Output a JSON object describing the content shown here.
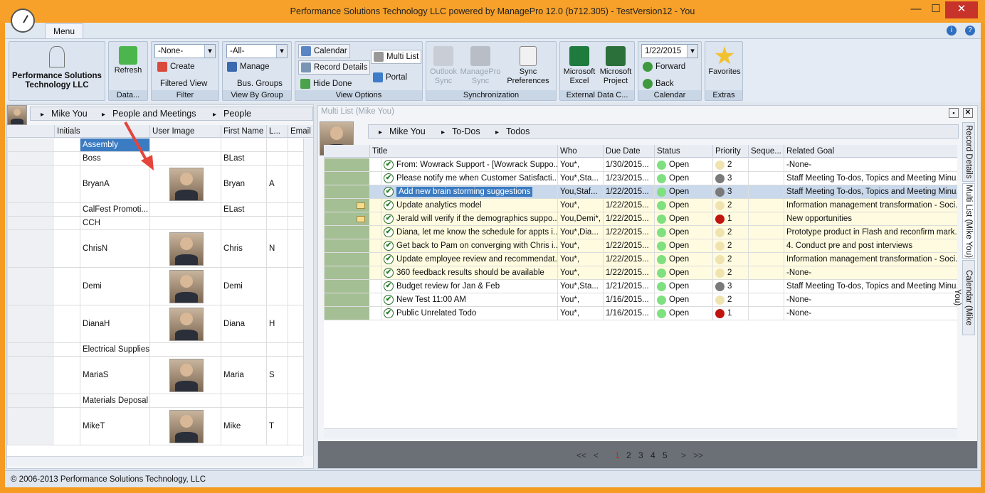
{
  "window": {
    "title": "Performance Solutions Technology LLC powered by ManagePro 12.0 (b712.305) - TestVersion12 - You",
    "min": "—",
    "max": "☐",
    "close": "✕"
  },
  "ribbon": {
    "tab": "Menu",
    "help_icons": [
      "i",
      "?"
    ],
    "logo_text": "Performance Solutions Technology LLC",
    "refresh": "Refresh",
    "filter_combo": "-None-",
    "create": "Create",
    "filtered_view": "Filtered View",
    "group_combo": "-All-",
    "manage": "Manage",
    "bus_groups": "Bus. Groups",
    "calendar": "Calendar",
    "record_details": "Record Details",
    "hide_done": "Hide Done",
    "multi_list": "Multi List",
    "portal": "Portal",
    "outlook_sync": "Outlook Sync",
    "managepro_sync": "ManagePro Sync",
    "sync_prefs": "Sync Preferences",
    "excel": "Microsoft Excel",
    "project": "Microsoft Project",
    "date": "1/22/2015",
    "forward": "Forward",
    "back": "Back",
    "favorites": "Favorites",
    "groups": [
      "Data...",
      "Filter",
      "View By Group",
      "View Options",
      "Synchronization",
      "External Data C...",
      "Calendar",
      "Extras"
    ]
  },
  "left": {
    "breadcrumb": [
      "Mike You",
      "People and Meetings",
      "People"
    ],
    "columns": [
      "Initials",
      "User Image",
      "First Name",
      "L...",
      "Email"
    ],
    "rows": [
      {
        "initials": "Assembly",
        "first": "",
        "last": "",
        "photo": false,
        "selected": true
      },
      {
        "initials": "Boss",
        "first": "BLast",
        "last": "",
        "photo": false
      },
      {
        "initials": "BryanA",
        "first": "Bryan",
        "last": "A",
        "photo": true
      },
      {
        "initials": "CalFest Promoti...",
        "first": "ELast",
        "last": "",
        "photo": false
      },
      {
        "initials": "CCH",
        "first": "",
        "last": "",
        "photo": false
      },
      {
        "initials": "ChrisN",
        "first": "Chris",
        "last": "N",
        "photo": true
      },
      {
        "initials": "Demi",
        "first": "Demi",
        "last": "",
        "photo": true
      },
      {
        "initials": "DianaH",
        "first": "Diana",
        "last": "H",
        "photo": true
      },
      {
        "initials": "Electrical Supplies",
        "first": "",
        "last": "",
        "photo": false
      },
      {
        "initials": "MariaS",
        "first": "Maria",
        "last": "S",
        "photo": true
      },
      {
        "initials": "Materials Deposal",
        "first": "",
        "last": "",
        "photo": false
      },
      {
        "initials": "MikeT",
        "first": "Mike",
        "last": "T",
        "photo": true
      }
    ]
  },
  "right": {
    "panel_title": "Multi List (Mike You)",
    "breadcrumb": [
      "Mike You",
      "To-Dos",
      "Todos"
    ],
    "columns": [
      "Title",
      "Who",
      "Due Date",
      "Status",
      "Priority",
      "Seque...",
      "Related Goal"
    ],
    "rows": [
      {
        "title": "From: Wowrack Support - [Wowrack Suppo...",
        "who": "You*,",
        "due": "1/30/2015...",
        "status": "Open",
        "prio": "2",
        "prio_color": "#efe3b0",
        "goal": "-None-",
        "bg": "#ffffff",
        "mail": false
      },
      {
        "title": "Please notify me when Customer Satisfacti...",
        "who": "You*,Sta...",
        "due": "1/23/2015...",
        "status": "Open",
        "prio": "3",
        "prio_color": "#7a7a7a",
        "goal": "Staff Meeting To-dos, Topics and Meeting Minu...",
        "bg": "#ffffff",
        "mail": false
      },
      {
        "title": "Add new brain storming suggestions",
        "who": "You,Staf...",
        "due": "1/22/2015...",
        "status": "Open",
        "prio": "3",
        "prio_color": "#7a7a7a",
        "goal": "Staff Meeting To-dos, Topics and Meeting Minu...",
        "bg": "#c9d8ea",
        "mail": false,
        "selected": true
      },
      {
        "title": "Update analytics model",
        "who": "You*,",
        "due": "1/22/2015...",
        "status": "Open",
        "prio": "2",
        "prio_color": "#efe3b0",
        "goal": "Information management transformation - Soci...",
        "bg": "#fffbe0",
        "mail": true
      },
      {
        "title": "Jerald will verify if the demographics suppo...",
        "who": "You,Demi*,",
        "due": "1/22/2015...",
        "status": "Open",
        "prio": "1",
        "prio_color": "#c0140f",
        "goal": "New opportunities",
        "bg": "#fffbe0",
        "mail": true
      },
      {
        "title": "Diana, let me know the schedule for appts i...",
        "who": "You*,Dia...",
        "due": "1/22/2015...",
        "status": "Open",
        "prio": "2",
        "prio_color": "#efe3b0",
        "goal": "Prototype product in Flash and reconfirm mark...",
        "bg": "#fffbe0",
        "mail": false
      },
      {
        "title": "Get back to Pam on converging with Chris i...",
        "who": "You*,",
        "due": "1/22/2015...",
        "status": "Open",
        "prio": "2",
        "prio_color": "#efe3b0",
        "goal": "4. Conduct pre and post interviews",
        "bg": "#fffbe0",
        "mail": false
      },
      {
        "title": "Update employee review and recommendat...",
        "who": "You*,",
        "due": "1/22/2015...",
        "status": "Open",
        "prio": "2",
        "prio_color": "#efe3b0",
        "goal": "Information management transformation - Soci...",
        "bg": "#fffbe0",
        "mail": false
      },
      {
        "title": "360 feedback results should be available",
        "who": "You*,",
        "due": "1/22/2015...",
        "status": "Open",
        "prio": "2",
        "prio_color": "#efe3b0",
        "goal": "-None-",
        "bg": "#fffbe0",
        "mail": false
      },
      {
        "title": "Budget review for Jan & Feb",
        "who": "You*,Sta...",
        "due": "1/21/2015...",
        "status": "Open",
        "prio": "3",
        "prio_color": "#7a7a7a",
        "goal": "Staff Meeting To-dos, Topics and Meeting Minu...",
        "bg": "#ffffff",
        "mail": false
      },
      {
        "title": "New Test 11:00 AM",
        "who": "You*,",
        "due": "1/16/2015...",
        "status": "Open",
        "prio": "2",
        "prio_color": "#efe3b0",
        "goal": "-None-",
        "bg": "#ffffff",
        "mail": false
      },
      {
        "title": "Public Unrelated Todo",
        "who": "You*,",
        "due": "1/16/2015...",
        "status": "Open",
        "prio": "1",
        "prio_color": "#c0140f",
        "goal": "-None-",
        "bg": "#ffffff",
        "mail": false
      }
    ],
    "pager": {
      "first": "<<",
      "prev": "<",
      "pages": [
        "1",
        "2",
        "3",
        "4",
        "5"
      ],
      "current": "1",
      "next": ">",
      "last": ">>"
    },
    "vtabs": [
      "Record Details",
      "Multi List (Mike You)",
      "Calendar (Mike You)"
    ]
  },
  "status": "© 2006-2013 Performance Solutions Technology, LLC"
}
